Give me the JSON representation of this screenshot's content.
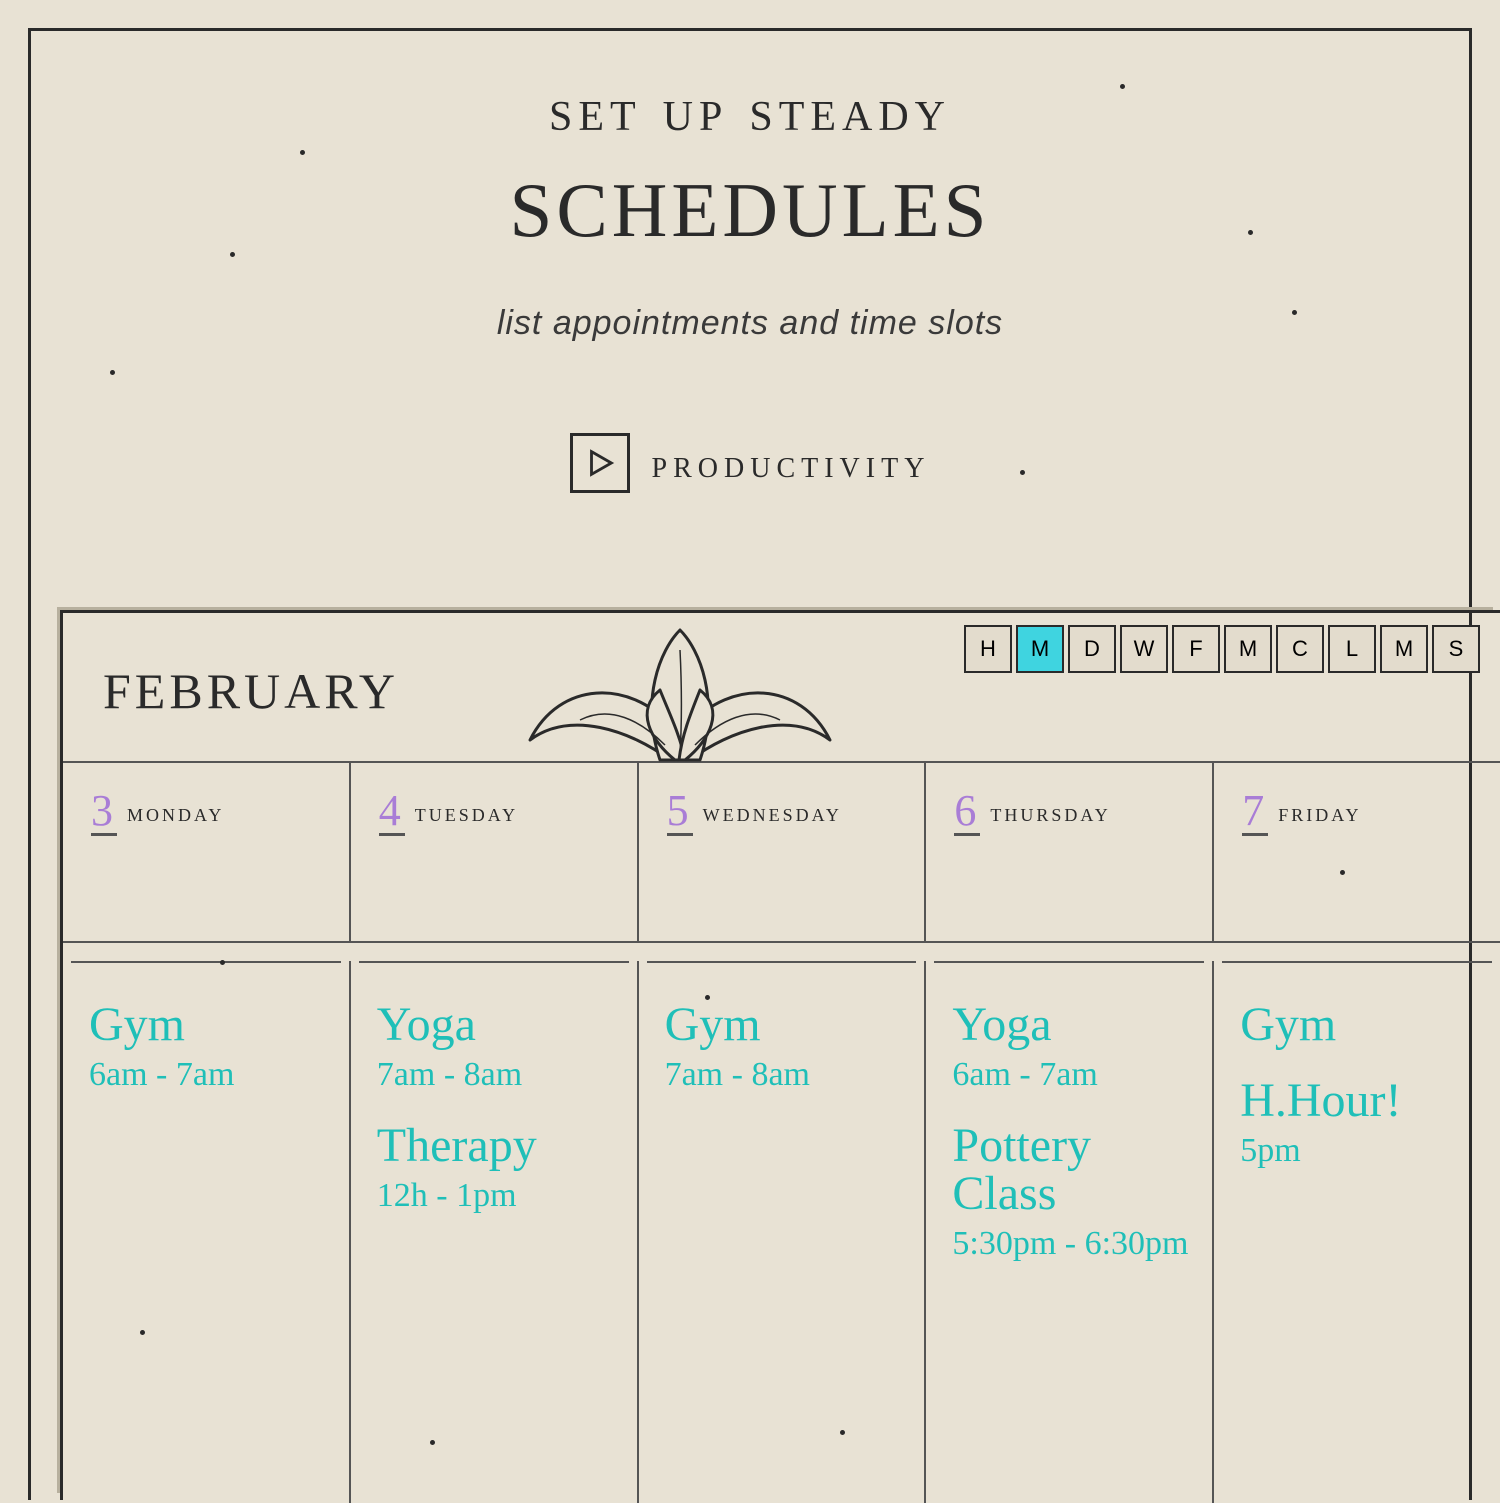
{
  "header": {
    "title_line1": "set up steady",
    "title_line2": "schedules",
    "subtitle": "list appointments and time slots",
    "category_label": "productivity"
  },
  "calendar": {
    "month": "february",
    "view_tabs": [
      "H",
      "M",
      "D",
      "W",
      "F",
      "M",
      "C",
      "L",
      "M",
      "S"
    ],
    "active_tab_index": 1,
    "days": [
      {
        "num": "3",
        "name": "monday"
      },
      {
        "num": "4",
        "name": "tuesday"
      },
      {
        "num": "5",
        "name": "wednesday"
      },
      {
        "num": "6",
        "name": "thursday"
      },
      {
        "num": "7",
        "name": "friday"
      }
    ],
    "entries": [
      [
        {
          "title": "Gym",
          "time": "6am - 7am"
        }
      ],
      [
        {
          "title": "Yoga",
          "time": "7am - 8am"
        },
        {
          "title": "Therapy",
          "time": "12h - 1pm"
        }
      ],
      [
        {
          "title": "Gym",
          "time": "7am - 8am"
        }
      ],
      [
        {
          "title": "Yoga",
          "time": "6am - 7am"
        },
        {
          "title": "Pottery Class",
          "time": "5:30pm - 6:30pm"
        }
      ],
      [
        {
          "title": "Gym",
          "time": ""
        },
        {
          "title": "H.Hour!",
          "time": "5pm"
        }
      ]
    ]
  },
  "colors": {
    "handwriting": "#1fbfb8",
    "daynum": "#a97dd6",
    "accent": "#3fd4e0"
  }
}
